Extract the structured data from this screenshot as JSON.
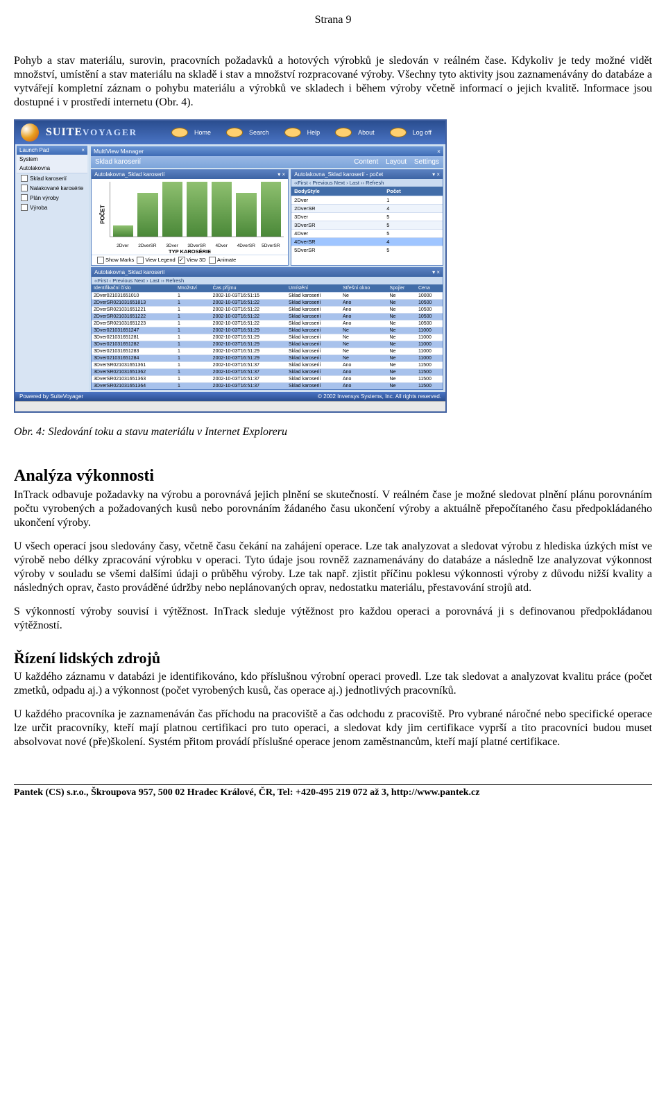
{
  "page_header": "Strana 9",
  "intro_para": "Pohyb a stav materiálu, surovin, pracovních požadavků a hotových výrobků je sledován v reálném čase. Kdykoliv je tedy možné vidět množství, umístění a stav materiálu na skladě i stav a množství rozpracované výroby. Všechny tyto aktivity jsou zaznamenávány do databáze a vytvářejí kompletní záznam o pohybu materiálu a výrobků ve skladech i během výroby včetně informací o jejich kvalitě. Informace jsou dostupné i v prostředí internetu (Obr. 4).",
  "fig_caption": "Obr. 4:  Sledování toku a stavu materiálu v Internet Exploreru",
  "analysis_heading": "Analýza výkonnosti",
  "analysis_p1": "InTrack odbavuje požadavky na výrobu a porovnává jejich plnění se skutečností. V reálném čase je možné sledovat plnění plánu porovnáním počtu vyrobených a požadovaných kusů nebo porovnáním žádaného času ukončení výroby a aktuálně přepočítaného času předpokládaného ukončení výroby.",
  "analysis_p2": "U všech operací jsou sledovány časy, včetně času čekání na zahájení operace. Lze tak analyzovat a sledovat výrobu z hlediska úzkých míst ve výrobě nebo délky zpracování výrobku v operaci. Tyto údaje jsou rovněž zaznamenávány do databáze a následně lze analyzovat výkonnost výroby v souladu se všemi dalšími údaji o průběhu výroby. Lze tak např. zjistit příčinu poklesu výkonnosti výroby z důvodu nižší kvality a následných oprav, často prováděné údržby nebo neplánovaných oprav, nedostatku materiálu, přestavování strojů atd.",
  "analysis_p3": "S výkonností výroby souvisí i výtěžnost. InTrack sleduje výtěžnost pro každou operaci a porovnává ji s definovanou předpokládanou výtěžností.",
  "hr_heading": "Řízení lidských zdrojů",
  "hr_p1": "U každého záznamu v databázi je identifikováno, kdo příslušnou výrobní operaci provedl. Lze tak sledovat a analyzovat kvalitu práce (počet zmetků, odpadu aj.) a výkonnost (počet vyrobených kusů, čas operace aj.) jednotlivých pracovníků.",
  "hr_p2": " U každého pracovníka je zaznamenáván čas příchodu na pracoviště a čas odchodu z pracoviště. Pro vybrané náročné nebo specifické operace lze určit pracovníky, kteří mají platnou certifikaci pro tuto operaci, a sledovat kdy jim certifikace vyprší a tito pracovníci budou muset absolvovat nové (pře)školení. Systém přitom provádí příslušné operace jenom zaměstnancům, kteří mají platné certifikace.",
  "footer": "Pantek (CS) s.r.o., Škroupova 957, 500 02 Hradec Králové, ČR, Tel: +420-495 219 072 až 3, http://www.pantek.cz",
  "sv": {
    "brand1": "SUITE",
    "brand2": "VOYAGER",
    "nav": [
      "Home",
      "Search",
      "Help",
      "About",
      "Log off"
    ],
    "side_launch": "Launch Pad",
    "side_sys": "System",
    "side_autolak": "Autolakovna",
    "side_items": [
      "Sklad karoserií",
      "Nalakované karosérie",
      "Plán výroby",
      "Výroba"
    ],
    "mv_mgr": "MultiView Manager",
    "crumb": "Sklad karoserií",
    "crumb_links": [
      "Content",
      "Layout",
      "Settings"
    ],
    "chart_panel_title": "Autolakovna_Sklad karoserií",
    "count_panel_title": "Autolakovna_Sklad karoserií - počet",
    "pager": "‹‹First  ‹ Previous Next ›  Last ››  Refresh",
    "count_cols": [
      "BodyStyle",
      "Počet"
    ],
    "count_rows": [
      [
        "2Dver",
        "1"
      ],
      [
        "2DverSR",
        "4"
      ],
      [
        "3Dver",
        "5"
      ],
      [
        "3DverSR",
        "5"
      ],
      [
        "4Dver",
        "5"
      ],
      [
        "4DverSR",
        "4"
      ],
      [
        "5DverSR",
        "5"
      ]
    ],
    "chart_opts": [
      "Show Marks",
      "View Legend",
      "View 3D",
      "Animate"
    ],
    "chart_title": "TYP KAROSÉRIE",
    "chart_ylabel": "POČET",
    "big_panel_title": "Autolakovna_Sklad karoserií",
    "big_cols": [
      "Identifikační číslo",
      "Množství",
      "Čas příjmu",
      "Umístění",
      "Střešní okno",
      "Spojler",
      "Cena"
    ],
    "big_rows": [
      [
        "2Dver021031651010",
        "1",
        "2002-10-03T16:51:15",
        "Sklad karoserií",
        "Ne",
        "Ne",
        "10000"
      ],
      [
        "2DverSR021031651813",
        "1",
        "2002-10-03T16:51:22",
        "Sklad karoserií",
        "Ano",
        "Ne",
        "10500"
      ],
      [
        "2DverSR021031651221",
        "1",
        "2002-10-03T16:51:22",
        "Sklad karoserií",
        "Ano",
        "Ne",
        "10500"
      ],
      [
        "2DverSR021031651222",
        "1",
        "2002-10-03T16:51:22",
        "Sklad karoserií",
        "Ano",
        "Ne",
        "10500"
      ],
      [
        "2DverSR021031651223",
        "1",
        "2002-10-03T16:51:22",
        "Sklad karoserií",
        "Ano",
        "Ne",
        "10500"
      ],
      [
        "3Dver021031651247",
        "1",
        "2002-10-03T16:51:29",
        "Sklad karoserií",
        "Ne",
        "Ne",
        "11000"
      ],
      [
        "3Dver021031651281",
        "1",
        "2002-10-03T16:51:29",
        "Sklad karoserií",
        "Ne",
        "Ne",
        "11000"
      ],
      [
        "3Dver021031651282",
        "1",
        "2002-10-03T16:51:29",
        "Sklad karoserií",
        "Ne",
        "Ne",
        "11000"
      ],
      [
        "3Dver021031651283",
        "1",
        "2002-10-03T16:51:29",
        "Sklad karoserií",
        "Ne",
        "Ne",
        "11000"
      ],
      [
        "3Dver021031651284",
        "1",
        "2002-10-03T16:51:29",
        "Sklad karoserií",
        "Ne",
        "Ne",
        "11000"
      ],
      [
        "3DverSR021031651361",
        "1",
        "2002-10-03T16:51:37",
        "Sklad karoserií",
        "Ano",
        "Ne",
        "11500"
      ],
      [
        "3DverSR021031651362",
        "1",
        "2002-10-03T16:51:37",
        "Sklad karoserií",
        "Ano",
        "Ne",
        "11500"
      ],
      [
        "3DverSR021031651363",
        "1",
        "2002-10-03T16:51:37",
        "Sklad karoserií",
        "Ano",
        "Ne",
        "11500"
      ],
      [
        "3DverSR021031651364",
        "1",
        "2002-10-03T16:51:37",
        "Sklad karoserií",
        "Ano",
        "Ne",
        "11500"
      ]
    ],
    "foot_left": "Powered by SuiteVoyager",
    "foot_right": "© 2002 Invensys Systems, Inc. All rights reserved."
  },
  "chart_data": {
    "type": "bar",
    "categories": [
      "2Dver",
      "2DverSR",
      "3Dver",
      "3DverSR",
      "4Dver",
      "4DverSR",
      "5DverSR"
    ],
    "values": [
      1,
      4,
      5,
      5,
      5,
      4,
      5
    ],
    "title": "TYP KAROSÉRIE",
    "xlabel": "TYP KAROSÉRIE",
    "ylabel": "POČET",
    "ylim": [
      0,
      5
    ]
  }
}
